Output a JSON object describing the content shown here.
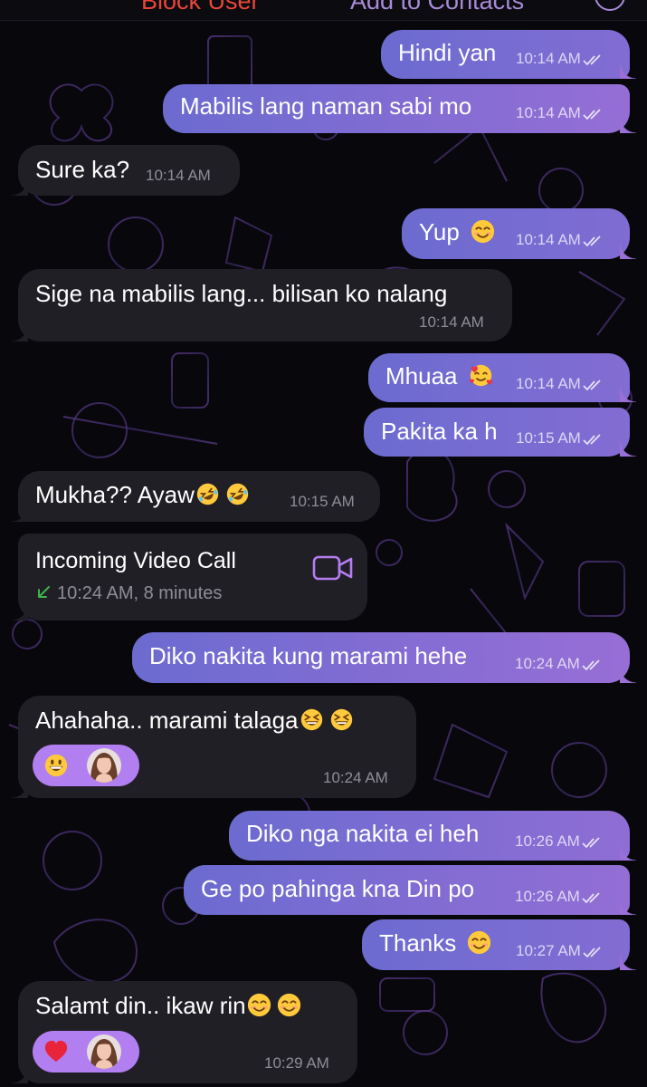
{
  "top_bar": {
    "block_label": "Block User",
    "add_label": "Add to Contacts"
  },
  "messages": [
    {
      "id": "m1",
      "dir": "out",
      "text": "Hindi yan",
      "time": "10:14 AM",
      "read": true
    },
    {
      "id": "m2",
      "dir": "out",
      "text": "Mabilis lang naman sabi mo",
      "time": "10:14 AM",
      "read": true
    },
    {
      "id": "m3",
      "dir": "in",
      "text": "Sure ka?",
      "time": "10:14 AM"
    },
    {
      "id": "m4",
      "dir": "out",
      "text": "Yup",
      "emoji": [
        "smiling-face"
      ],
      "time": "10:14 AM",
      "read": true
    },
    {
      "id": "m5",
      "dir": "in",
      "text": "Sige na mabilis lang... bilisan ko nalang",
      "time": "10:14 AM"
    },
    {
      "id": "m6",
      "dir": "out",
      "text": "Mhuaa",
      "emoji": [
        "smiling-face-with-hearts"
      ],
      "time": "10:14 AM",
      "read": true
    },
    {
      "id": "m7",
      "dir": "out",
      "text": "Pakita ka h",
      "time": "10:15 AM",
      "read": true
    },
    {
      "id": "m8",
      "dir": "in",
      "text": "Mukha?? Ayaw",
      "emoji": [
        "rolling-laughing",
        "rolling-laughing"
      ],
      "time": "10:15 AM"
    },
    {
      "id": "m9",
      "dir": "in",
      "type": "call",
      "title": "Incoming Video Call",
      "subtitle": "10:24 AM, 8 minutes"
    },
    {
      "id": "m10",
      "dir": "out",
      "text": "Diko nakita kung marami hehe",
      "time": "10:24 AM",
      "read": true
    },
    {
      "id": "m11",
      "dir": "in",
      "text": "Ahahaha.. marami talaga",
      "emoji": [
        "grinning-squinting",
        "grinning-squinting"
      ],
      "time": "10:24 AM",
      "reaction": "grinning-face"
    },
    {
      "id": "m12",
      "dir": "out",
      "text": "Diko nga nakita ei heh",
      "time": "10:26 AM",
      "read": true
    },
    {
      "id": "m13",
      "dir": "out",
      "text": "Ge po pahinga kna Din po",
      "time": "10:26 AM",
      "read": true
    },
    {
      "id": "m14",
      "dir": "out",
      "text": "Thanks",
      "emoji": [
        "smiling-face"
      ],
      "time": "10:27 AM",
      "read": true
    },
    {
      "id": "m15",
      "dir": "in",
      "text": "Salamt din.. ikaw rin",
      "emoji": [
        "smiling-face",
        "smiling-face"
      ],
      "time": "10:29 AM",
      "reaction": "red-heart"
    }
  ],
  "colors": {
    "outgoing_start": "#6c6bd0",
    "outgoing_end": "#a46fd7",
    "incoming": "#211f26",
    "reaction_pill": "#b17ff0",
    "call_icon": "#b47cf0",
    "call_arrow": "#3fb24a",
    "block_text": "#e9463a"
  }
}
